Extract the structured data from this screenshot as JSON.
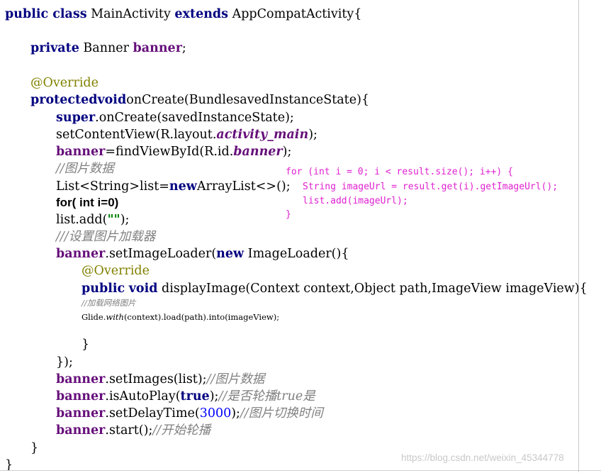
{
  "code": {
    "l1": [
      "public class",
      " MainActivity ",
      "extends",
      " AppCompatActivity{"
    ],
    "l2": [
      "private",
      " Banner ",
      "banner",
      ";"
    ],
    "l3": [
      "@Override"
    ],
    "l4": [
      "protectedvoid",
      "onCreate(BundlesavedInstanceState){"
    ],
    "l5": [
      "super",
      ".onCreate(savedInstanceState);"
    ],
    "l6": [
      "setContentView(R.layout.",
      "activity_main",
      ");"
    ],
    "l7": [
      "banner",
      "=findViewById(R.id.",
      "banner",
      ");"
    ],
    "l8": [
      "//图片数据"
    ],
    "l9": [
      "List<String>list=",
      "new",
      "ArrayList<>();"
    ],
    "l10": [
      "for( int i=0)"
    ],
    "l11": [
      "list.add(",
      "\"\"",
      ");"
    ],
    "l12": [
      "///设置图片加载器"
    ],
    "l13": [
      "banner",
      ".setImageLoader(",
      "new",
      " ImageLoader(){"
    ],
    "l14": [
      "@Override"
    ],
    "l15": [
      "public",
      " ",
      "void",
      " displayImage(Context context,Object path,ImageView imageView){"
    ],
    "l16": [
      "//加载网络图片"
    ],
    "l17": [
      "Glide.",
      "with",
      "(context).load(path).into(imageView);"
    ],
    "l18": [
      "}"
    ],
    "l19": [
      "});"
    ],
    "l20": [
      "banner",
      ".setImages(list);",
      "//图片数据"
    ],
    "l21": [
      "banner",
      ".isAutoPlay(",
      "true",
      ");",
      "//是否轮播true是"
    ],
    "l22": [
      "banner",
      ".setDelayTime(",
      "3000",
      ");",
      "//图片切换时间"
    ],
    "l23": [
      "banner",
      ".start();",
      "//开始轮播"
    ],
    "l24": [
      "}"
    ],
    "l25": [
      "}"
    ]
  },
  "note": {
    "line1": "for (int i = 0; i < result.size(); i++) {",
    "line2": "String imageUrl = result.get(i).getImageUrl();",
    "line3": "list.add(imageUrl);",
    "line4": "}"
  },
  "watermark": "https://blog.csdn.net/weixin_45344778",
  "colors": {
    "keyword": "#000080",
    "field": "#660e7a",
    "comment": "#808080",
    "annotation": "#808000",
    "number": "#0000ff",
    "note": "#e020d0"
  }
}
